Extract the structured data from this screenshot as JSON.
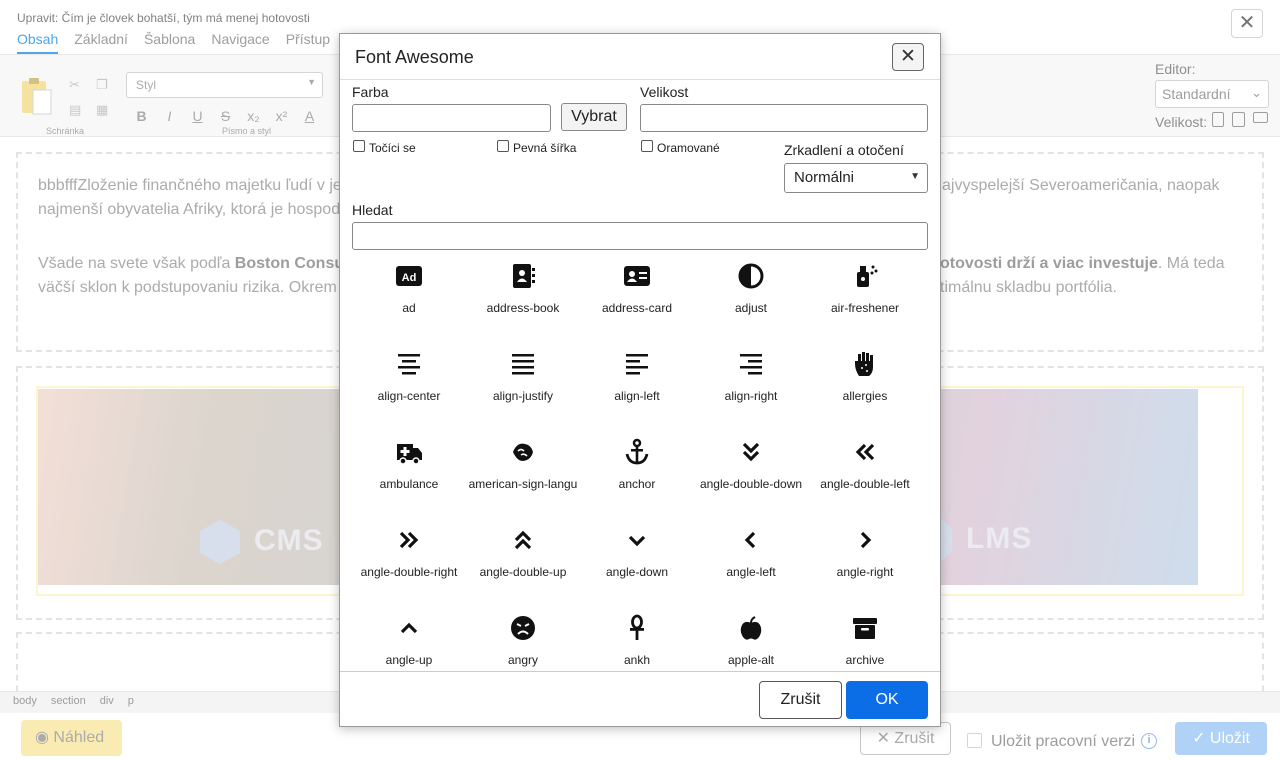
{
  "window": {
    "title": "Upravit: Čím je človek bohatší, tým má menej hotovosti",
    "close_glyph": "✕"
  },
  "tabs": [
    "Obsah",
    "Základní",
    "Šablona",
    "Navigace",
    "Přístup"
  ],
  "toolbar": {
    "clipboard_group_label": "Schránka",
    "font_group_label": "Písmo a styl",
    "style_placeholder": "Styl",
    "format_buttons": [
      "B",
      "I",
      "U",
      "S",
      "x₂",
      "x²",
      "A"
    ],
    "editor_label": "Editor:",
    "editor_value": "Standardní",
    "size_label": "Velikost:"
  },
  "content": {
    "para1_line1_start": "bbbfffZloženie finančného majetku ľudí v je",
    "para1_line1_end": "ajvyspelejší Severoameričania, naopak",
    "para1_line2": "najmenší obyvatelia Afriky, ktorá je hospod",
    "para2_line1_start": "Všade na svete však podľa ",
    "para2_line1_bold": "Boston Consu",
    "para2_line1_mid_bold": "otovosti drží a viac investuje",
    "para2_line1_end": ". Má teda",
    "para2_line2_start": "väčší sklon k podstupovaniu rizika. Okrem",
    "para2_line2_end": "timálnu skladbu portfólia.",
    "logo_left": "CMS",
    "logo_right": "LMS"
  },
  "path": [
    "body",
    "section",
    "div",
    "p"
  ],
  "footer": {
    "preview_label": "Náhled",
    "cancel_label": "Zrušit",
    "save_draft_label": "Uložit pracovní verzi",
    "save_label": "Uložit"
  },
  "dialog": {
    "title": "Font Awesome",
    "color_label": "Farba",
    "pick_button": "Vybrat",
    "size_label": "Velikost",
    "spin_label": "Točíci se",
    "fixed_width_label": "Pevná šířka",
    "bordered_label": "Oramované",
    "mirror_label": "Zrkadlení a otočení",
    "mirror_value": "Normálni",
    "search_label": "Hledat",
    "cancel_button": "Zrušit",
    "ok_button": "OK",
    "icons": [
      {
        "name": "ad",
        "icon": "ad-icon"
      },
      {
        "name": "address-book",
        "icon": "address-book-icon"
      },
      {
        "name": "address-card",
        "icon": "address-card-icon"
      },
      {
        "name": "adjust",
        "icon": "adjust-icon"
      },
      {
        "name": "air-freshener",
        "icon": "air-freshener-icon"
      },
      {
        "name": "align-center",
        "icon": "align-center-icon"
      },
      {
        "name": "align-justify",
        "icon": "align-justify-icon"
      },
      {
        "name": "align-left",
        "icon": "align-left-icon"
      },
      {
        "name": "align-right",
        "icon": "align-right-icon"
      },
      {
        "name": "allergies",
        "icon": "allergies-icon"
      },
      {
        "name": "ambulance",
        "icon": "ambulance-icon"
      },
      {
        "name": "american-sign-langu",
        "icon": "american-sign-language-icon"
      },
      {
        "name": "anchor",
        "icon": "anchor-icon"
      },
      {
        "name": "angle-double-down",
        "icon": "angle-double-down-icon"
      },
      {
        "name": "angle-double-left",
        "icon": "angle-double-left-icon"
      },
      {
        "name": "angle-double-right",
        "icon": "angle-double-right-icon"
      },
      {
        "name": "angle-double-up",
        "icon": "angle-double-up-icon"
      },
      {
        "name": "angle-down",
        "icon": "angle-down-icon"
      },
      {
        "name": "angle-left",
        "icon": "angle-left-icon"
      },
      {
        "name": "angle-right",
        "icon": "angle-right-icon"
      },
      {
        "name": "angle-up",
        "icon": "angle-up-icon"
      },
      {
        "name": "angry",
        "icon": "angry-icon"
      },
      {
        "name": "ankh",
        "icon": "ankh-icon"
      },
      {
        "name": "apple-alt",
        "icon": "apple-alt-icon"
      },
      {
        "name": "archive",
        "icon": "archive-icon"
      }
    ]
  },
  "colors": {
    "accent": "#2a93e6",
    "ok_button": "#0b6ee6",
    "preview_button": "#f9e7a3",
    "save_button": "#9fc8f5"
  }
}
